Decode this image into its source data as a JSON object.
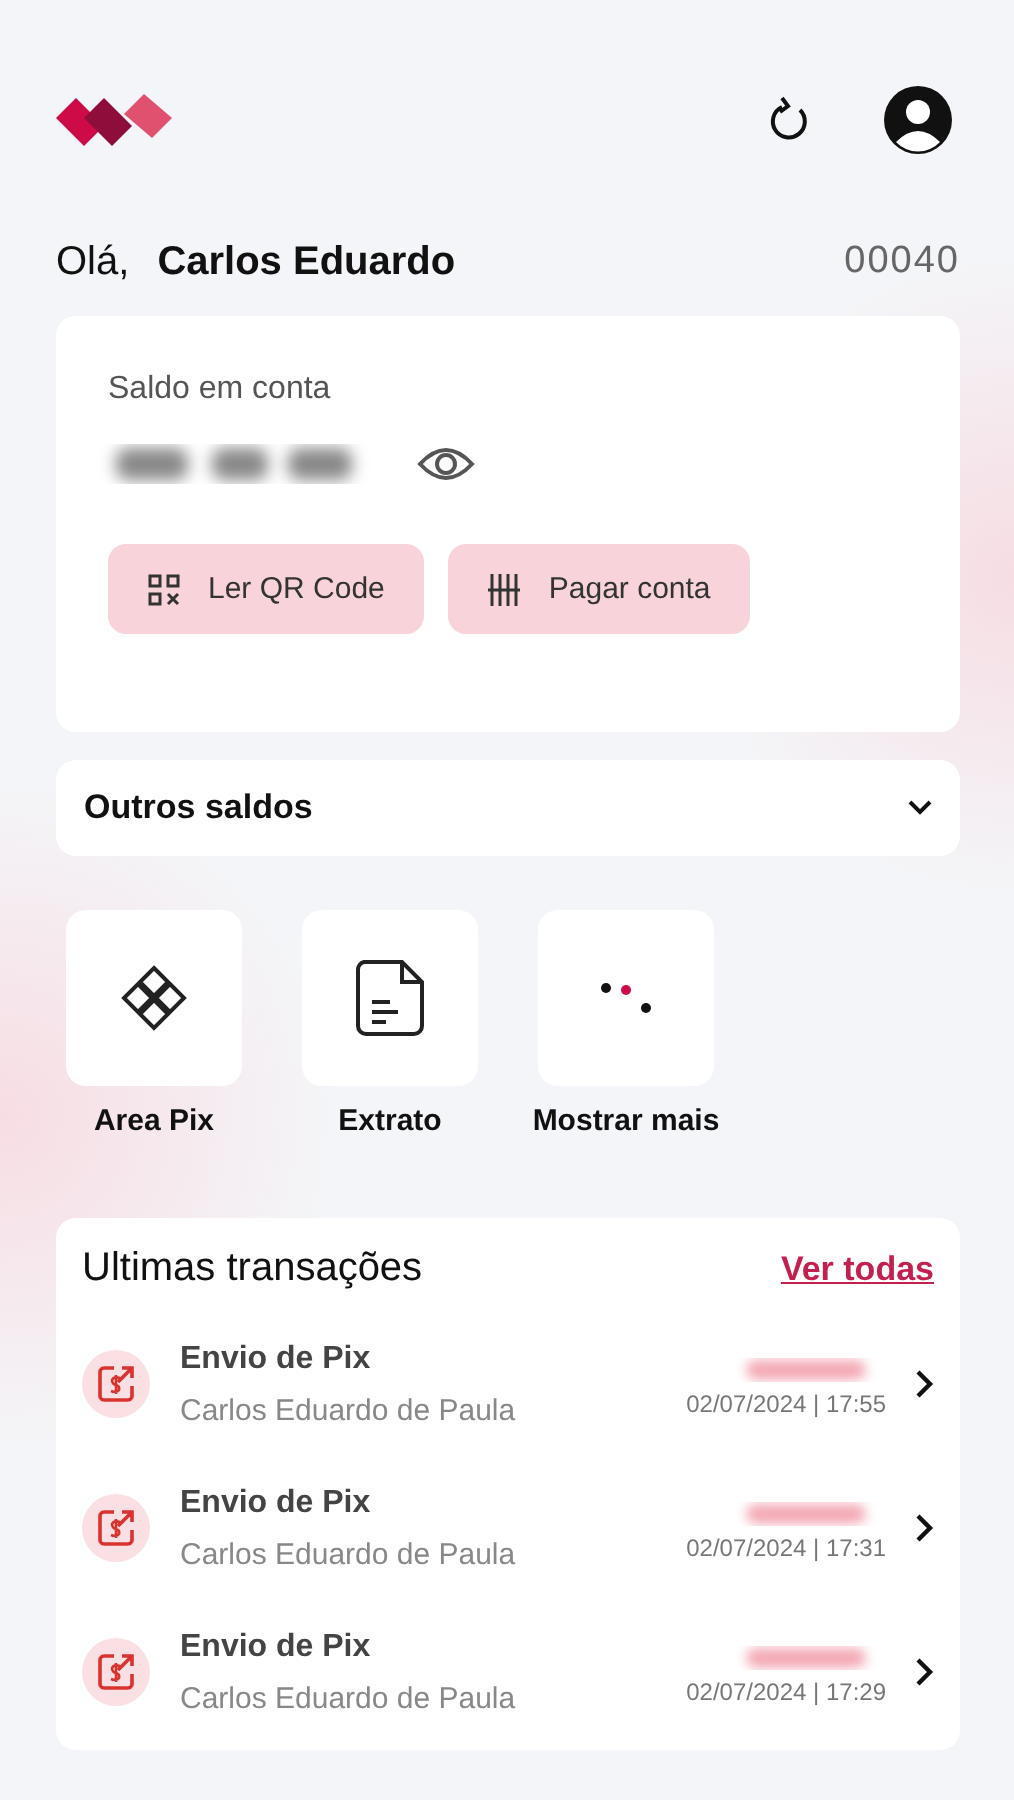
{
  "greeting": {
    "hello": "Olá,",
    "name": "Carlos Eduardo",
    "account": "00040"
  },
  "balance": {
    "label": "Saldo em conta",
    "actions": [
      {
        "kind": "qr",
        "label": "Ler QR Code"
      },
      {
        "kind": "barcode",
        "label": "Pagar conta"
      }
    ]
  },
  "other_balances": {
    "label": "Outros saldos",
    "expanded": false
  },
  "shortcuts": [
    {
      "kind": "pix",
      "label": "Area Pix"
    },
    {
      "kind": "statement",
      "label": "Extrato"
    },
    {
      "kind": "more",
      "label": "Mostrar mais"
    }
  ],
  "transactions": {
    "title": "Ultimas transações",
    "link": "Ver todas",
    "items": [
      {
        "title": "Envio de Pix",
        "name": "Carlos Eduardo de Paula",
        "date": "02/07/2024 | 17:55"
      },
      {
        "title": "Envio de Pix",
        "name": "Carlos Eduardo de Paula",
        "date": "02/07/2024 | 17:31"
      },
      {
        "title": "Envio de Pix",
        "name": "Carlos Eduardo de Paula",
        "date": "02/07/2024 | 17:29"
      }
    ]
  }
}
